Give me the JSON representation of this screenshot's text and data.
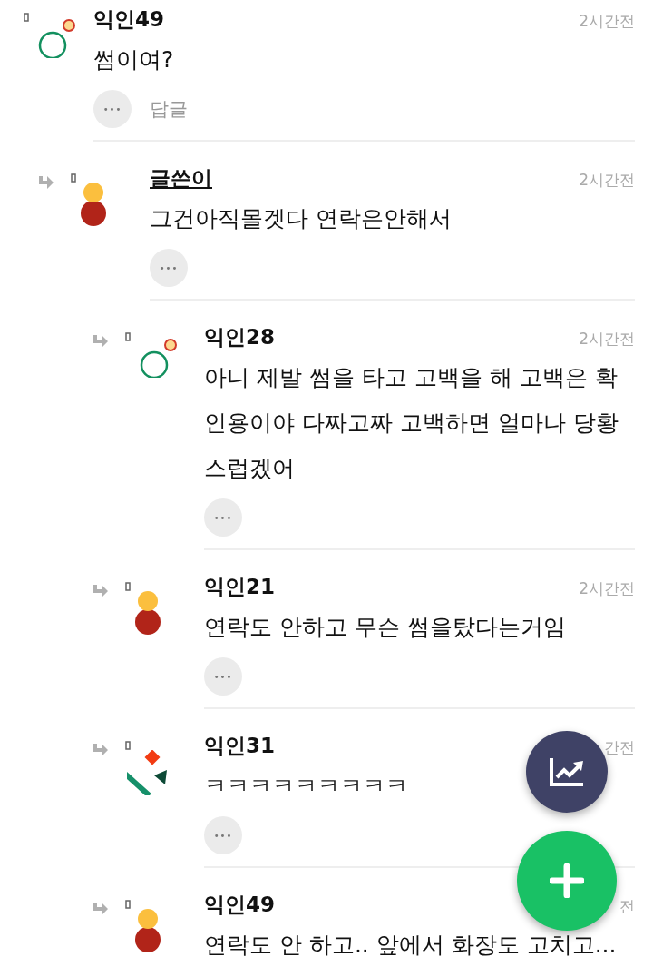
{
  "comments": [
    {
      "author": "익인49",
      "is_author": false,
      "time": "2시간전",
      "body": "썸이여?",
      "avatar": {
        "kind": "ring"
      },
      "reply_label": "답글",
      "more": "•••",
      "children": [
        {
          "author": "글쓴이",
          "is_author": true,
          "time": "2시간전",
          "body": "그건아직몰겟다 연락은안해서",
          "avatar": {
            "kind": "figure"
          },
          "more": "•••",
          "children": [
            {
              "author": "익인28",
              "is_author": false,
              "time": "2시간전",
              "body": "아니 제발 썸을 타고 고백을 해 고백은 확인용이야 다짜고짜 고백하면 얼마나 당황스럽겠어",
              "avatar": {
                "kind": "ring"
              },
              "more": "•••"
            },
            {
              "author": "익인21",
              "is_author": false,
              "time": "2시간전",
              "body": "연락도 안하고 무슨 썸을탔다는거임",
              "avatar": {
                "kind": "figure"
              },
              "more": "•••"
            },
            {
              "author": "익인31",
              "is_author": false,
              "time": "간전",
              "body": "ㅋㅋㅋㅋㅋㅋㅋㅋㅋ",
              "avatar": {
                "kind": "shapes"
              },
              "more": "•••"
            },
            {
              "author": "익인49",
              "is_author": false,
              "time": "전",
              "body": "연락도 안 하고.. 앞에서 화장도 고치고...",
              "avatar": {
                "kind": "figure"
              }
            }
          ]
        }
      ]
    }
  ],
  "fabs": [
    {
      "kind": "chart"
    },
    {
      "kind": "add"
    }
  ]
}
